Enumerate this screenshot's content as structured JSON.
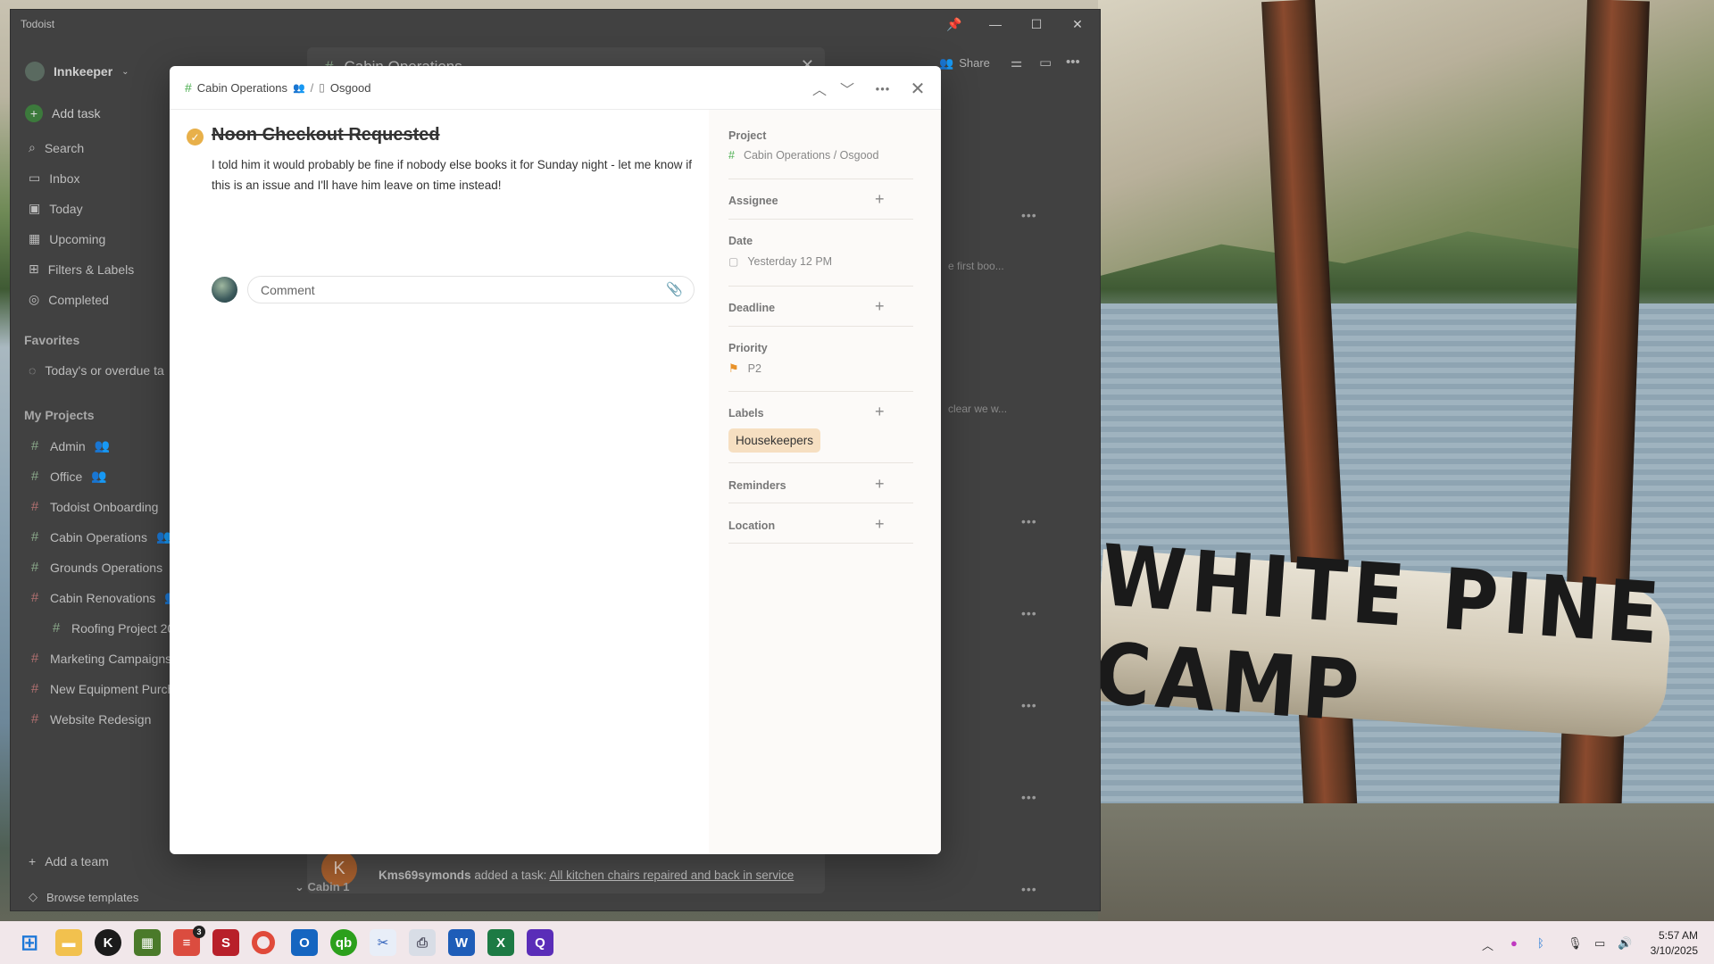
{
  "window": {
    "title": "Todoist"
  },
  "sidebar": {
    "workspace": "Innkeeper",
    "add_task": "Add task",
    "nav": [
      "Search",
      "Inbox",
      "Today",
      "Upcoming",
      "Filters & Labels",
      "Completed"
    ],
    "favorites_header": "Favorites",
    "favorites": [
      "Today's or overdue ta"
    ],
    "projects_header": "My Projects",
    "projects": [
      {
        "name": "Admin",
        "shared": true
      },
      {
        "name": "Office",
        "shared": true
      },
      {
        "name": "Todoist Onboarding",
        "shared": true
      },
      {
        "name": "Cabin Operations",
        "shared": true
      },
      {
        "name": "Grounds Operations",
        "shared": true
      },
      {
        "name": "Cabin Renovations",
        "shared": true
      },
      {
        "name": "Roofing Project 20",
        "shared": false
      },
      {
        "name": "Marketing Campaigns",
        "shared": false
      },
      {
        "name": "New Equipment Purch",
        "shared": false
      },
      {
        "name": "Website Redesign",
        "shared": false
      }
    ],
    "add_team": "Add a team",
    "browse_templates": "Browse templates"
  },
  "background_panel": {
    "title": "Cabin Operations",
    "share_label": "Share",
    "activity_user": "Kms69symonds",
    "activity_verb": "added a task:",
    "activity_task": "All kitchen chairs repaired and back in service",
    "section_label": "Cabin 1",
    "peek_text_1": "e first boo...",
    "peek_text_2": "clear we w..."
  },
  "task_modal": {
    "breadcrumb_project": "Cabin Operations",
    "breadcrumb_section": "Osgood",
    "title": "Noon Checkout Requested",
    "description": "I told him it would probably be fine if nobody else books it for Sunday night - let me know if this is an issue and I'll have him leave on time instead!",
    "comment_placeholder": "Comment",
    "fields": {
      "project_label": "Project",
      "project_value": "Cabin Operations / Osgood",
      "assignee_label": "Assignee",
      "date_label": "Date",
      "date_value": "Yesterday 12 PM",
      "deadline_label": "Deadline",
      "priority_label": "Priority",
      "priority_value": "P2",
      "labels_label": "Labels",
      "label_chip": "Housekeepers",
      "reminders_label": "Reminders",
      "location_label": "Location"
    },
    "colors": {
      "priority_flag": "#e8922a",
      "label_chip_bg": "#f6dfc1",
      "check_fill": "#e8b04a"
    }
  },
  "wallpaper": {
    "sign_text": "WHITE PINE CAMP"
  },
  "taskbar": {
    "todoist_badge": "3",
    "time": "5:57 AM",
    "date": "3/10/2025"
  }
}
